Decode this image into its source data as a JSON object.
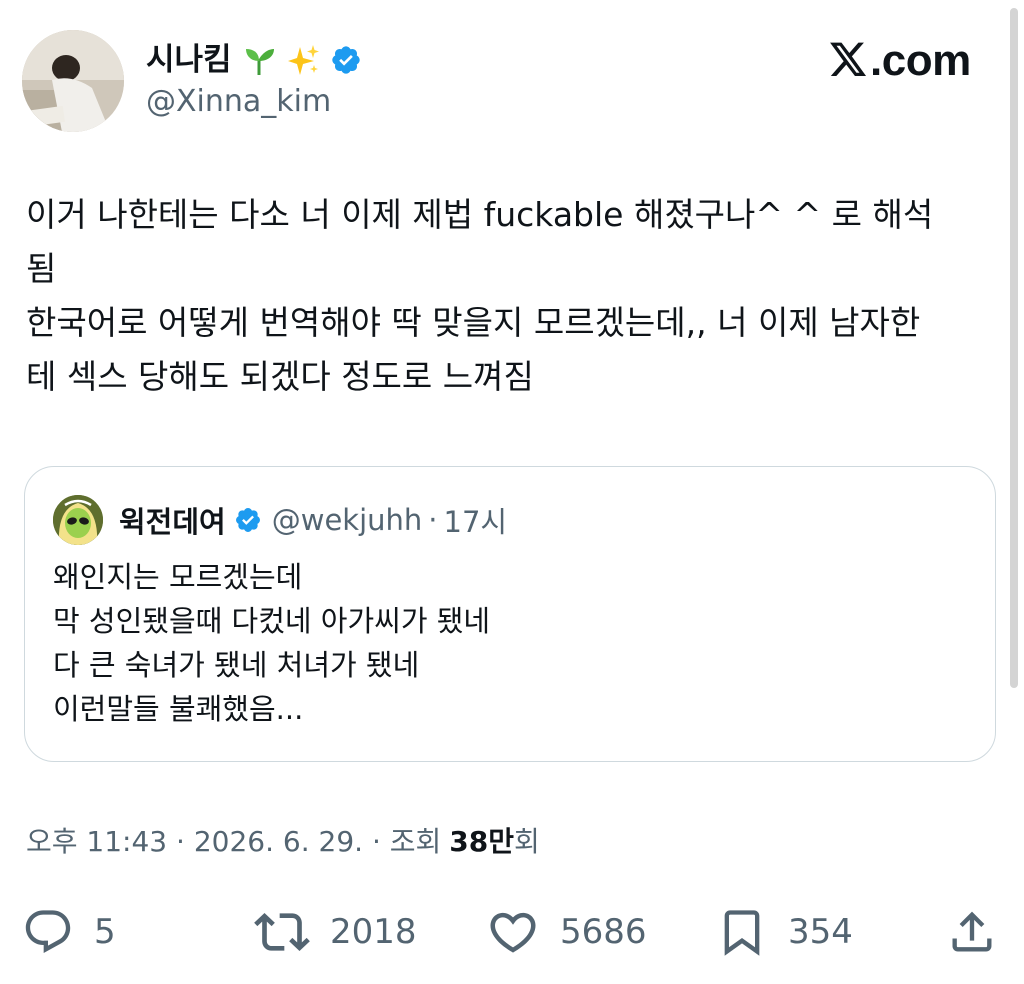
{
  "author": {
    "display_name": "시나킴",
    "handle": "@Xinna_kim",
    "emojis": [
      "seedling-emoji",
      "sparkles-emoji"
    ],
    "verified": true
  },
  "site_logo": ".com",
  "tweet": {
    "lines": [
      "이거 나한테는 다소 너 이제 제법 fuckable 해졌구나^ ^ 로 해석",
      "됨",
      "한국어로 어떻게 번역해야 딱 맞을지 모르겠는데,, 너 이제 남자한",
      "테 섹스 당해도 되겠다 정도로 느껴짐"
    ]
  },
  "quote": {
    "display_name": "윅전데여",
    "handle": "@wekjuhh",
    "separator": "·",
    "time": "17시",
    "verified": true,
    "lines": [
      "왜인지는 모르겠는데",
      "막 성인됐을때 다컸네 아가씨가 됐네",
      "다 큰 숙녀가 됐네 처녀가 됐네",
      "이런말들 불쾌했음..."
    ]
  },
  "meta": {
    "time": "오후 11:43",
    "separator": "·",
    "date": "2026. 6. 29.",
    "views_prefix": "조회",
    "views_count": "38만",
    "views_suffix": "회"
  },
  "actions": {
    "replies": "5",
    "retweets": "2018",
    "likes": "5686",
    "bookmarks": "354"
  },
  "colors": {
    "text": "#0f1419",
    "secondary": "#536471",
    "verified": "#1d9bf0",
    "border": "#cfd9de"
  }
}
